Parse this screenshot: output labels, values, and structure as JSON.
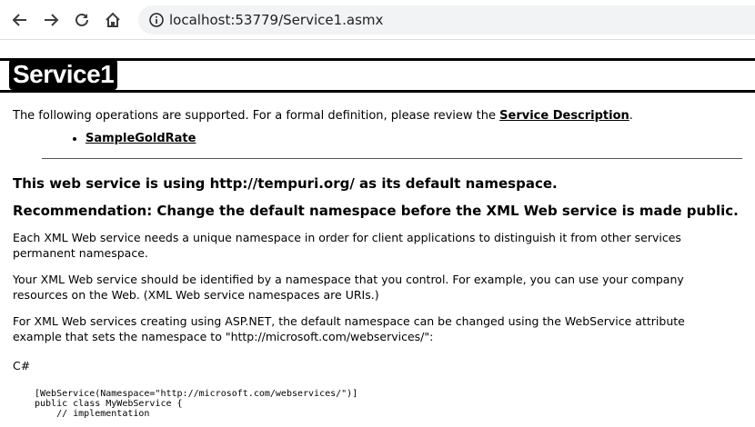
{
  "browser": {
    "url": "localhost:53779/Service1.asmx",
    "back_icon": "arrow-left-icon",
    "forward_icon": "arrow-right-icon",
    "reload_icon": "reload-icon",
    "home_icon": "home-icon",
    "info_icon": "info-icon"
  },
  "service": {
    "title": "Service1",
    "intro_text": "The following operations are supported. For a formal definition, please review the ",
    "service_description_link": "Service Description",
    "intro_end": ".",
    "operations": [
      "SampleGoldRate"
    ],
    "namespace_heading": "This web service is using http://tempuri.org/ as its default namespace.",
    "recommendation_heading": "Recommendation: Change the default namespace before the XML Web service is made public.",
    "para1_line1": "Each XML Web service needs a unique namespace in order for client applications to distinguish it from other services",
    "para1_line2": "permanent namespace.",
    "para2_line1": "Your XML Web service should be identified by a namespace that you control. For example, you can use your company",
    "para2_line2": "resources on the Web. (XML Web service namespaces are URIs.)",
    "para3_line1": "For XML Web services creating using ASP.NET, the default namespace can be changed using the WebService attribute",
    "para3_line2": "example that sets the namespace to \"http://microsoft.com/webservices/\":",
    "language_label": "C#",
    "code_line1": "[WebService(Namespace=\"http://microsoft.com/webservices/\")]",
    "code_line2": "public class MyWebService {",
    "code_line3": "    // implementation"
  }
}
